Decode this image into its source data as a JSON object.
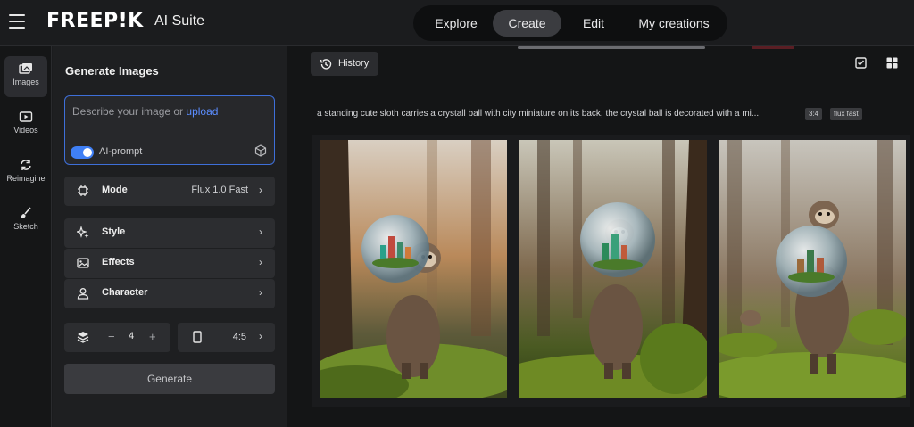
{
  "topbar": {
    "logo": "FREEP!K",
    "suite": "AI Suite",
    "tabs": [
      {
        "label": "Explore"
      },
      {
        "label": "Create",
        "active": true
      },
      {
        "label": "Edit"
      },
      {
        "label": "My creations"
      }
    ]
  },
  "leftnav": {
    "items": [
      {
        "label": "Images",
        "icon": "images-icon",
        "active": true
      },
      {
        "label": "Videos",
        "icon": "video-icon"
      },
      {
        "label": "Reimagine",
        "icon": "refresh-icon"
      },
      {
        "label": "Sketch",
        "icon": "brush-icon"
      }
    ]
  },
  "panel": {
    "title": "Generate Images",
    "prompt_placeholder": "Describe your image or ",
    "prompt_link": "upload",
    "ai_prompt_label": "AI-prompt",
    "ai_prompt_enabled": true,
    "mode": {
      "label": "Mode",
      "value": "Flux 1.0 Fast"
    },
    "style": {
      "label": "Style"
    },
    "effects": {
      "label": "Effects"
    },
    "character": {
      "label": "Character"
    },
    "count": {
      "minus": "−",
      "value": "4",
      "plus": "+"
    },
    "ratio": {
      "value": "4:5"
    },
    "generate_label": "Generate"
  },
  "main": {
    "history_label": "History",
    "prompt_text": "a standing cute sloth carries a crystall ball with city miniature on its back, the crystal ball is decorated with a mi...",
    "tags": [
      "3:4",
      "flux fast"
    ],
    "images": [
      {
        "alt": "sloth with crystal ball 1"
      },
      {
        "alt": "sloth with crystal ball 2"
      },
      {
        "alt": "sloth with crystal ball 3"
      }
    ]
  },
  "colors": {
    "accent": "#3e6fd9",
    "link": "#5b8dff",
    "toggle": "#3f7ff5",
    "background": "#1b1c1e"
  }
}
